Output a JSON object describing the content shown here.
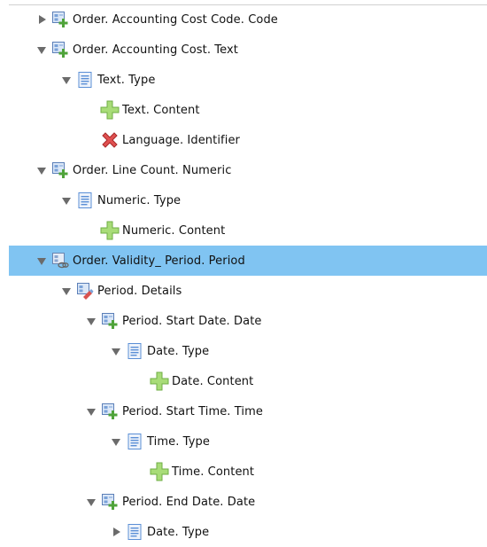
{
  "tree": {
    "nodes": [
      {
        "label": "Order. Accounting Cost Code. Code",
        "depth": 0,
        "expander": "collapsed",
        "icon": "element-add-icon"
      },
      {
        "label": "Order. Accounting Cost. Text",
        "depth": 0,
        "expander": "expanded",
        "icon": "element-add-icon"
      },
      {
        "label": "Text. Type",
        "depth": 1,
        "expander": "expanded",
        "icon": "document-icon"
      },
      {
        "label": "Text. Content",
        "depth": 2,
        "expander": "none",
        "icon": "plus-icon"
      },
      {
        "label": "Language. Identifier",
        "depth": 2,
        "expander": "none",
        "icon": "cross-icon"
      },
      {
        "label": "Order. Line Count. Numeric",
        "depth": 0,
        "expander": "expanded",
        "icon": "element-add-icon"
      },
      {
        "label": "Numeric. Type",
        "depth": 1,
        "expander": "expanded",
        "icon": "document-icon"
      },
      {
        "label": "Numeric. Content",
        "depth": 2,
        "expander": "none",
        "icon": "plus-icon"
      },
      {
        "label": "Order. Validity_ Period. Period",
        "depth": 0,
        "expander": "expanded",
        "icon": "element-link-icon",
        "selected": true
      },
      {
        "label": "Period. Details",
        "depth": 1,
        "expander": "expanded",
        "icon": "element-edit-icon"
      },
      {
        "label": "Period. Start Date. Date",
        "depth": 2,
        "expander": "expanded",
        "icon": "element-add-icon"
      },
      {
        "label": "Date. Type",
        "depth": 3,
        "expander": "expanded",
        "icon": "document-icon"
      },
      {
        "label": "Date. Content",
        "depth": 4,
        "expander": "none",
        "icon": "plus-icon"
      },
      {
        "label": "Period. Start Time. Time",
        "depth": 2,
        "expander": "expanded",
        "icon": "element-add-icon"
      },
      {
        "label": "Time. Type",
        "depth": 3,
        "expander": "expanded",
        "icon": "document-icon"
      },
      {
        "label": "Time. Content",
        "depth": 4,
        "expander": "none",
        "icon": "plus-icon"
      },
      {
        "label": "Period. End Date. Date",
        "depth": 2,
        "expander": "expanded",
        "icon": "element-add-icon"
      },
      {
        "label": "Date. Type",
        "depth": 3,
        "expander": "collapsed",
        "icon": "document-icon"
      }
    ]
  },
  "colors": {
    "selection": "#80c4f2",
    "expander": "#6b6b6b",
    "plus_green": "#9bd36b",
    "cross_red": "#e04a4a",
    "doc_blue": "#5b8fd6"
  }
}
